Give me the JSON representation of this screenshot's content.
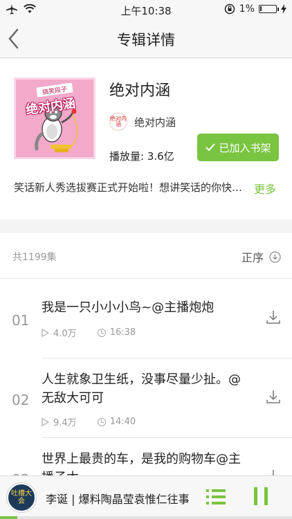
{
  "status_bar": {
    "time": "上午10:38",
    "battery_pct": "1%",
    "battery_level": 0.01
  },
  "nav": {
    "title": "专辑详情"
  },
  "album": {
    "cover_caption": "搞笑段子",
    "cover_title": "绝对内涵",
    "name": "绝对内涵",
    "author_avatar_text": "绝对内涵",
    "author": "绝对内涵",
    "plays": "播放量: 3.6亿",
    "shelf_button": "已加入书架",
    "description": "笑话新人秀选拔赛正式开始啦！想讲笑话的你快来参加吧",
    "more": "更多"
  },
  "list": {
    "count": "共1199集",
    "order": "正序",
    "episodes": [
      {
        "num": "01",
        "title": "我是一只小小小鸟~@主播炮炮",
        "plays": "4.0万",
        "duration": "16:38"
      },
      {
        "num": "02",
        "title": "人生就象卫生纸，没事尽量少扯。@无敌大可可",
        "plays": "9.4万",
        "duration": "14:40"
      },
      {
        "num": "03",
        "title": "世界上最贵的车，是我的购物车@主播子木",
        "plays": "",
        "duration": ""
      }
    ]
  },
  "player": {
    "thumb_text": "吐槽大会",
    "title": "李诞 | 爆料陶晶莹袁惟仁往事",
    "progress": 0.06
  },
  "colors": {
    "accent": "#79c440"
  }
}
